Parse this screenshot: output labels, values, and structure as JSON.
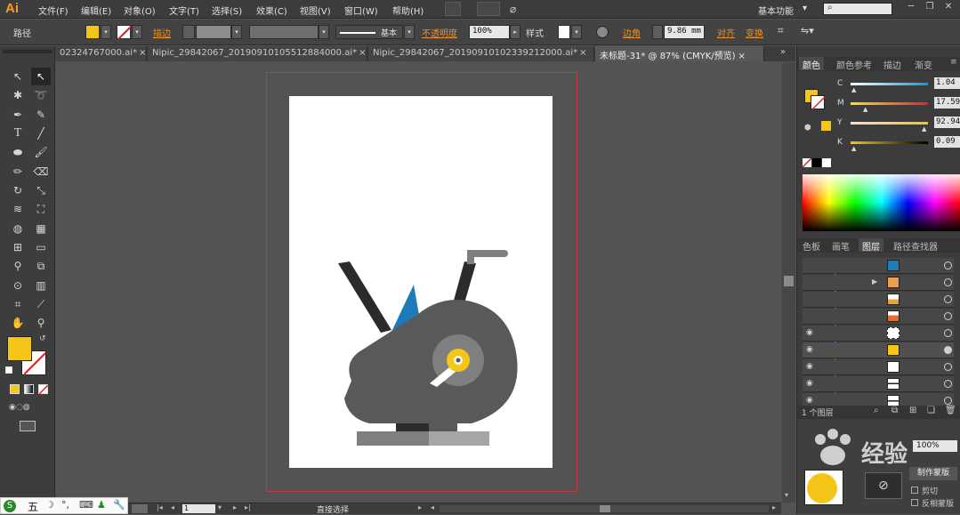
{
  "app": {
    "logo": "Ai"
  },
  "menu": [
    "文件(F)",
    "编辑(E)",
    "对象(O)",
    "文字(T)",
    "选择(S)",
    "效果(C)",
    "视图(V)",
    "窗口(W)",
    "帮助(H)"
  ],
  "workspace": {
    "label": "基本功能",
    "caret": "▾"
  },
  "search": {
    "placeholder": ""
  },
  "control": {
    "object_type": "路径",
    "stroke_label": "描边",
    "stroke_preset": "基本",
    "opacity_label": "不透明度",
    "opacity_value": "100%",
    "style_label": "样式",
    "corner_label": "边角",
    "corner_value": "9.86 mm",
    "align_label": "对齐",
    "transform_label": "变换",
    "fill_color": "#f5c518"
  },
  "tabs": [
    {
      "label": "02324767000.ai*",
      "close": "×"
    },
    {
      "label": "Nipic_29842067_20190910105512884000.ai*",
      "close": "×"
    },
    {
      "label": "Nipic_29842067_20190910102339212000.ai*",
      "close": "×"
    },
    {
      "label": "未标题-31* @ 87% (CMYK/预览)",
      "close": "×"
    }
  ],
  "colors_panel": {
    "tabs": [
      "颜色",
      "颜色参考",
      "描边",
      "渐变"
    ],
    "channels": [
      {
        "label": "C",
        "value": "1.04"
      },
      {
        "label": "M",
        "value": "17.59"
      },
      {
        "label": "Y",
        "value": "92.94"
      },
      {
        "label": "K",
        "value": "0.09"
      }
    ]
  },
  "layers_panel": {
    "tabs": [
      "色板",
      "画笔",
      "图层",
      "路径查找器"
    ],
    "footer": "1 个图层",
    "row_count": 9
  },
  "status": {
    "zoom": "87%",
    "page": "1",
    "tool": "直接选择"
  },
  "ime": {
    "label": "五"
  },
  "overlay_panel": {
    "percent": "100%",
    "btn": "制作蒙版",
    "opt1": "剪切",
    "opt2": "反相蒙版"
  },
  "watermark": {
    "text": "经验"
  },
  "accent": {
    "yellow": "#f5c518",
    "blue": "#1e7ab8",
    "dark": "#58595b",
    "darker": "#2b2b2b",
    "gray": "#7f7f7f",
    "light": "#a6a6a6"
  }
}
